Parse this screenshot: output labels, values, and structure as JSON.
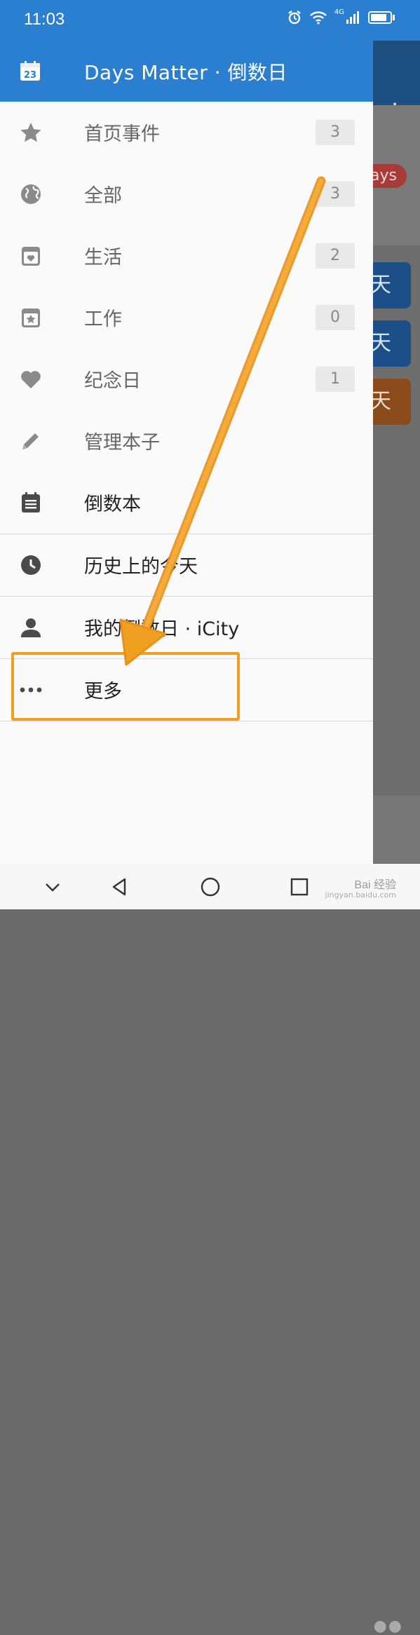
{
  "status_bar": {
    "time": "11:03",
    "icons": [
      "alarm-icon",
      "wifi-icon",
      "4g-signal-icon",
      "battery-icon"
    ],
    "network": "4G"
  },
  "background_app": {
    "days_badge": "ays",
    "card_1_text": "天",
    "card_2_text": "天",
    "card_3_text": "天",
    "add_icon": "+"
  },
  "drawer": {
    "header": {
      "icon_text": "23",
      "title": "Days Matter · 倒数日"
    },
    "items": [
      {
        "label": "首页事件",
        "count": "3",
        "icon": "star-icon"
      },
      {
        "label": "全部",
        "count": "3",
        "icon": "globe-icon"
      },
      {
        "label": "生活",
        "count": "2",
        "icon": "life-notebook-icon"
      },
      {
        "label": "工作",
        "count": "0",
        "icon": "work-notebook-icon"
      },
      {
        "label": "纪念日",
        "count": "1",
        "icon": "heart-icon"
      },
      {
        "label": "管理本子",
        "icon": "pencil-icon"
      },
      {
        "label": "倒数本",
        "icon": "list-notebook-icon"
      },
      {
        "label": "历史上的今天",
        "icon": "clock-icon"
      },
      {
        "label": "我的倒数日 · iCity",
        "icon": "person-icon"
      },
      {
        "label": "更多",
        "icon": "more-dots-icon"
      }
    ]
  },
  "watermark": {
    "text": "Bai 经验",
    "sub": "jingyan.baidu.com"
  },
  "colors": {
    "primary": "#2b7fd0",
    "drawer_bg": "#fafafa",
    "annotation": "#f0a020"
  }
}
